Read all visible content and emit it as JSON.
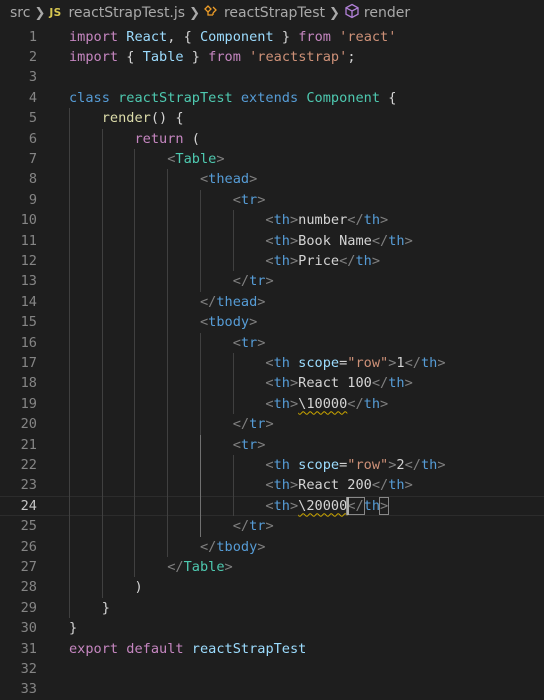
{
  "breadcrumb": {
    "folder": "src",
    "file_badge": "JS",
    "file": "reactStrapTest.js",
    "class_name": "reactStrapTest",
    "method": "render",
    "class_icon": "symbol-class-icon",
    "method_icon": "symbol-method-icon",
    "separator_icon": "chevron-right-icon"
  },
  "editor": {
    "current_line": 24,
    "colors": {
      "background": "#1e1e1e",
      "keyword_control": "#c586c0",
      "keyword": "#569cd6",
      "class_name": "#4ec9b0",
      "variable": "#9cdcfe",
      "function": "#dcdcaa",
      "string": "#ce9178",
      "number": "#b5cea8",
      "tag_bracket": "#808080",
      "text": "#d4d4d4",
      "warning_squiggle": "#cca700"
    },
    "lines": [
      {
        "n": "1",
        "tokens": [
          [
            "import",
            "k"
          ],
          [
            " ",
            "t"
          ],
          [
            "React",
            "v"
          ],
          [
            ", { ",
            "t"
          ],
          [
            "Component",
            "v"
          ],
          [
            " } ",
            "t"
          ],
          [
            "from",
            "k"
          ],
          [
            " ",
            "t"
          ],
          [
            "'react'",
            "s"
          ]
        ]
      },
      {
        "n": "2",
        "tokens": [
          [
            "import",
            "k"
          ],
          [
            " { ",
            "t"
          ],
          [
            "Table",
            "v"
          ],
          [
            " } ",
            "t"
          ],
          [
            "from",
            "k"
          ],
          [
            " ",
            "t"
          ],
          [
            "'reactstrap'",
            "s"
          ],
          [
            ";",
            "t"
          ]
        ]
      },
      {
        "n": "3",
        "tokens": []
      },
      {
        "n": "4",
        "tokens": [
          [
            "class",
            "b"
          ],
          [
            " ",
            "t"
          ],
          [
            "reactStrapTest",
            "c"
          ],
          [
            " ",
            "t"
          ],
          [
            "extends",
            "b"
          ],
          [
            " ",
            "t"
          ],
          [
            "Component",
            "c"
          ],
          [
            " {",
            "t"
          ]
        ]
      },
      {
        "n": "5",
        "tokens": [
          [
            "    ",
            "t"
          ],
          [
            "render",
            "f"
          ],
          [
            "() {",
            "t"
          ]
        ]
      },
      {
        "n": "6",
        "tokens": [
          [
            "        ",
            "t"
          ],
          [
            "return",
            "k"
          ],
          [
            " (",
            "t"
          ]
        ]
      },
      {
        "n": "7",
        "tokens": [
          [
            "            ",
            "t"
          ],
          [
            "<",
            "g"
          ],
          [
            "Table",
            "c"
          ],
          [
            ">",
            "g"
          ]
        ]
      },
      {
        "n": "8",
        "tokens": [
          [
            "                ",
            "t"
          ],
          [
            "<",
            "g"
          ],
          [
            "thead",
            "b"
          ],
          [
            ">",
            "g"
          ]
        ]
      },
      {
        "n": "9",
        "tokens": [
          [
            "                    ",
            "t"
          ],
          [
            "<",
            "g"
          ],
          [
            "tr",
            "b"
          ],
          [
            ">",
            "g"
          ]
        ]
      },
      {
        "n": "10",
        "tokens": [
          [
            "                        ",
            "t"
          ],
          [
            "<",
            "g"
          ],
          [
            "th",
            "b"
          ],
          [
            ">",
            "g"
          ],
          [
            "number",
            "t"
          ],
          [
            "</",
            "g"
          ],
          [
            "th",
            "b"
          ],
          [
            ">",
            "g"
          ]
        ]
      },
      {
        "n": "11",
        "tokens": [
          [
            "                        ",
            "t"
          ],
          [
            "<",
            "g"
          ],
          [
            "th",
            "b"
          ],
          [
            ">",
            "g"
          ],
          [
            "Book Name",
            "t"
          ],
          [
            "</",
            "g"
          ],
          [
            "th",
            "b"
          ],
          [
            ">",
            "g"
          ]
        ]
      },
      {
        "n": "12",
        "tokens": [
          [
            "                        ",
            "t"
          ],
          [
            "<",
            "g"
          ],
          [
            "th",
            "b"
          ],
          [
            ">",
            "g"
          ],
          [
            "Price",
            "t"
          ],
          [
            "</",
            "g"
          ],
          [
            "th",
            "b"
          ],
          [
            ">",
            "g"
          ]
        ]
      },
      {
        "n": "13",
        "tokens": [
          [
            "                    ",
            "t"
          ],
          [
            "</",
            "g"
          ],
          [
            "tr",
            "b"
          ],
          [
            ">",
            "g"
          ]
        ]
      },
      {
        "n": "14",
        "tokens": [
          [
            "                ",
            "t"
          ],
          [
            "</",
            "g"
          ],
          [
            "thead",
            "b"
          ],
          [
            ">",
            "g"
          ]
        ]
      },
      {
        "n": "15",
        "tokens": [
          [
            "                ",
            "t"
          ],
          [
            "<",
            "g"
          ],
          [
            "tbody",
            "b"
          ],
          [
            ">",
            "g"
          ]
        ]
      },
      {
        "n": "16",
        "tokens": [
          [
            "                    ",
            "t"
          ],
          [
            "<",
            "g"
          ],
          [
            "tr",
            "b"
          ],
          [
            ">",
            "g"
          ]
        ]
      },
      {
        "n": "17",
        "tokens": [
          [
            "                        ",
            "t"
          ],
          [
            "<",
            "g"
          ],
          [
            "th",
            "b"
          ],
          [
            " ",
            "t"
          ],
          [
            "scope",
            "v"
          ],
          [
            "=",
            "t"
          ],
          [
            "\"row\"",
            "s"
          ],
          [
            ">",
            "g"
          ],
          [
            "1",
            "t"
          ],
          [
            "</",
            "g"
          ],
          [
            "th",
            "b"
          ],
          [
            ">",
            "g"
          ]
        ]
      },
      {
        "n": "18",
        "tokens": [
          [
            "                        ",
            "t"
          ],
          [
            "<",
            "g"
          ],
          [
            "th",
            "b"
          ],
          [
            ">",
            "g"
          ],
          [
            "React 100",
            "t"
          ],
          [
            "</",
            "g"
          ],
          [
            "th",
            "b"
          ],
          [
            ">",
            "g"
          ]
        ]
      },
      {
        "n": "19",
        "tokens": [
          [
            "                        ",
            "t"
          ],
          [
            "<",
            "g"
          ],
          [
            "th",
            "b"
          ],
          [
            ">",
            "g"
          ],
          [
            "\\10000",
            "w"
          ],
          [
            "</",
            "g"
          ],
          [
            "th",
            "b"
          ],
          [
            ">",
            "g"
          ]
        ]
      },
      {
        "n": "20",
        "tokens": [
          [
            "                    ",
            "t"
          ],
          [
            "</",
            "g"
          ],
          [
            "tr",
            "b"
          ],
          [
            ">",
            "g"
          ]
        ]
      },
      {
        "n": "21",
        "tokens": [
          [
            "                    ",
            "t"
          ],
          [
            "<",
            "g"
          ],
          [
            "tr",
            "b"
          ],
          [
            ">",
            "g"
          ]
        ]
      },
      {
        "n": "22",
        "tokens": [
          [
            "                        ",
            "t"
          ],
          [
            "<",
            "g"
          ],
          [
            "th",
            "b"
          ],
          [
            " ",
            "t"
          ],
          [
            "scope",
            "v"
          ],
          [
            "=",
            "t"
          ],
          [
            "\"row\"",
            "s"
          ],
          [
            ">",
            "g"
          ],
          [
            "2",
            "t"
          ],
          [
            "</",
            "g"
          ],
          [
            "th",
            "b"
          ],
          [
            ">",
            "g"
          ]
        ]
      },
      {
        "n": "23",
        "tokens": [
          [
            "                        ",
            "t"
          ],
          [
            "<",
            "g"
          ],
          [
            "th",
            "b"
          ],
          [
            ">",
            "g"
          ],
          [
            "React 200",
            "t"
          ],
          [
            "</",
            "g"
          ],
          [
            "th",
            "b"
          ],
          [
            ">",
            "g"
          ]
        ]
      },
      {
        "n": "24",
        "tokens": [
          [
            "                        ",
            "t"
          ],
          [
            "<",
            "g"
          ],
          [
            "th",
            "b"
          ],
          [
            ">",
            "g"
          ],
          [
            "\\20000",
            "w"
          ],
          [
            "</",
            "m"
          ],
          [
            "th",
            "b"
          ],
          [
            ">",
            "m"
          ]
        ]
      },
      {
        "n": "25",
        "tokens": [
          [
            "                    ",
            "t"
          ],
          [
            "</",
            "g"
          ],
          [
            "tr",
            "b"
          ],
          [
            ">",
            "g"
          ]
        ]
      },
      {
        "n": "26",
        "tokens": [
          [
            "                ",
            "t"
          ],
          [
            "</",
            "g"
          ],
          [
            "tbody",
            "b"
          ],
          [
            ">",
            "g"
          ]
        ]
      },
      {
        "n": "27",
        "tokens": [
          [
            "            ",
            "t"
          ],
          [
            "</",
            "g"
          ],
          [
            "Table",
            "c"
          ],
          [
            ">",
            "g"
          ]
        ]
      },
      {
        "n": "28",
        "tokens": [
          [
            "        ",
            "t"
          ],
          [
            ")",
            "t"
          ]
        ]
      },
      {
        "n": "29",
        "tokens": [
          [
            "    ",
            "t"
          ],
          [
            "}",
            "t"
          ]
        ]
      },
      {
        "n": "30",
        "tokens": [
          [
            "}",
            "t"
          ]
        ]
      },
      {
        "n": "31",
        "tokens": [
          [
            "export",
            "k"
          ],
          [
            " ",
            "t"
          ],
          [
            "default",
            "k"
          ],
          [
            " ",
            "t"
          ],
          [
            "reactStrapTest",
            "v"
          ]
        ]
      },
      {
        "n": "32",
        "tokens": []
      },
      {
        "n": "33",
        "tokens": []
      }
    ]
  }
}
